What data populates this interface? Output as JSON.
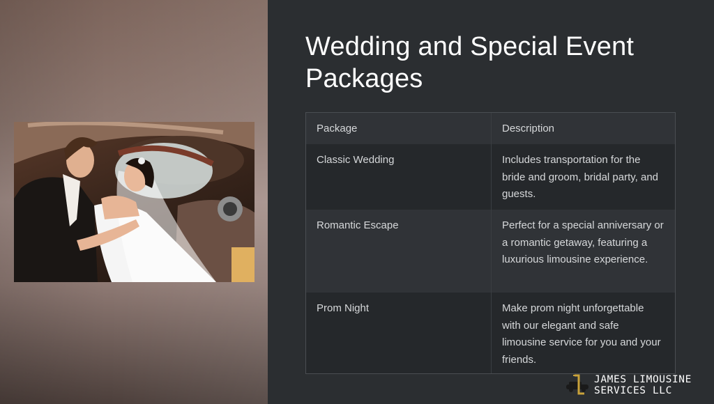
{
  "slide": {
    "title": "Wedding and Special Event Packages"
  },
  "table": {
    "headers": [
      "Package",
      "Description"
    ],
    "rows": [
      {
        "package": "Classic Wedding",
        "description": "Includes transportation for the bride and groom, bridal party, and guests."
      },
      {
        "package": "Romantic Escape",
        "description": "Perfect for a special anniversary or a romantic getaway, featuring a luxurious limousine experience."
      },
      {
        "package": "Prom Night",
        "description": "Make prom night unforgettable with our elegant and safe limousine service for you and your friends."
      }
    ]
  },
  "brand": {
    "line1": "JAMES LIMOUSINE",
    "line2": "SERVICES LLC",
    "logo_icon": "limousine-logo-icon"
  },
  "image": {
    "subject": "wedding-couple-photo"
  },
  "colors": {
    "background": "#2b2e31",
    "title": "#ffffff",
    "table_text": "#d6d8da",
    "row_dark": "#25282b",
    "row_light": "#303337",
    "logo_gold": "#c9a23a"
  }
}
